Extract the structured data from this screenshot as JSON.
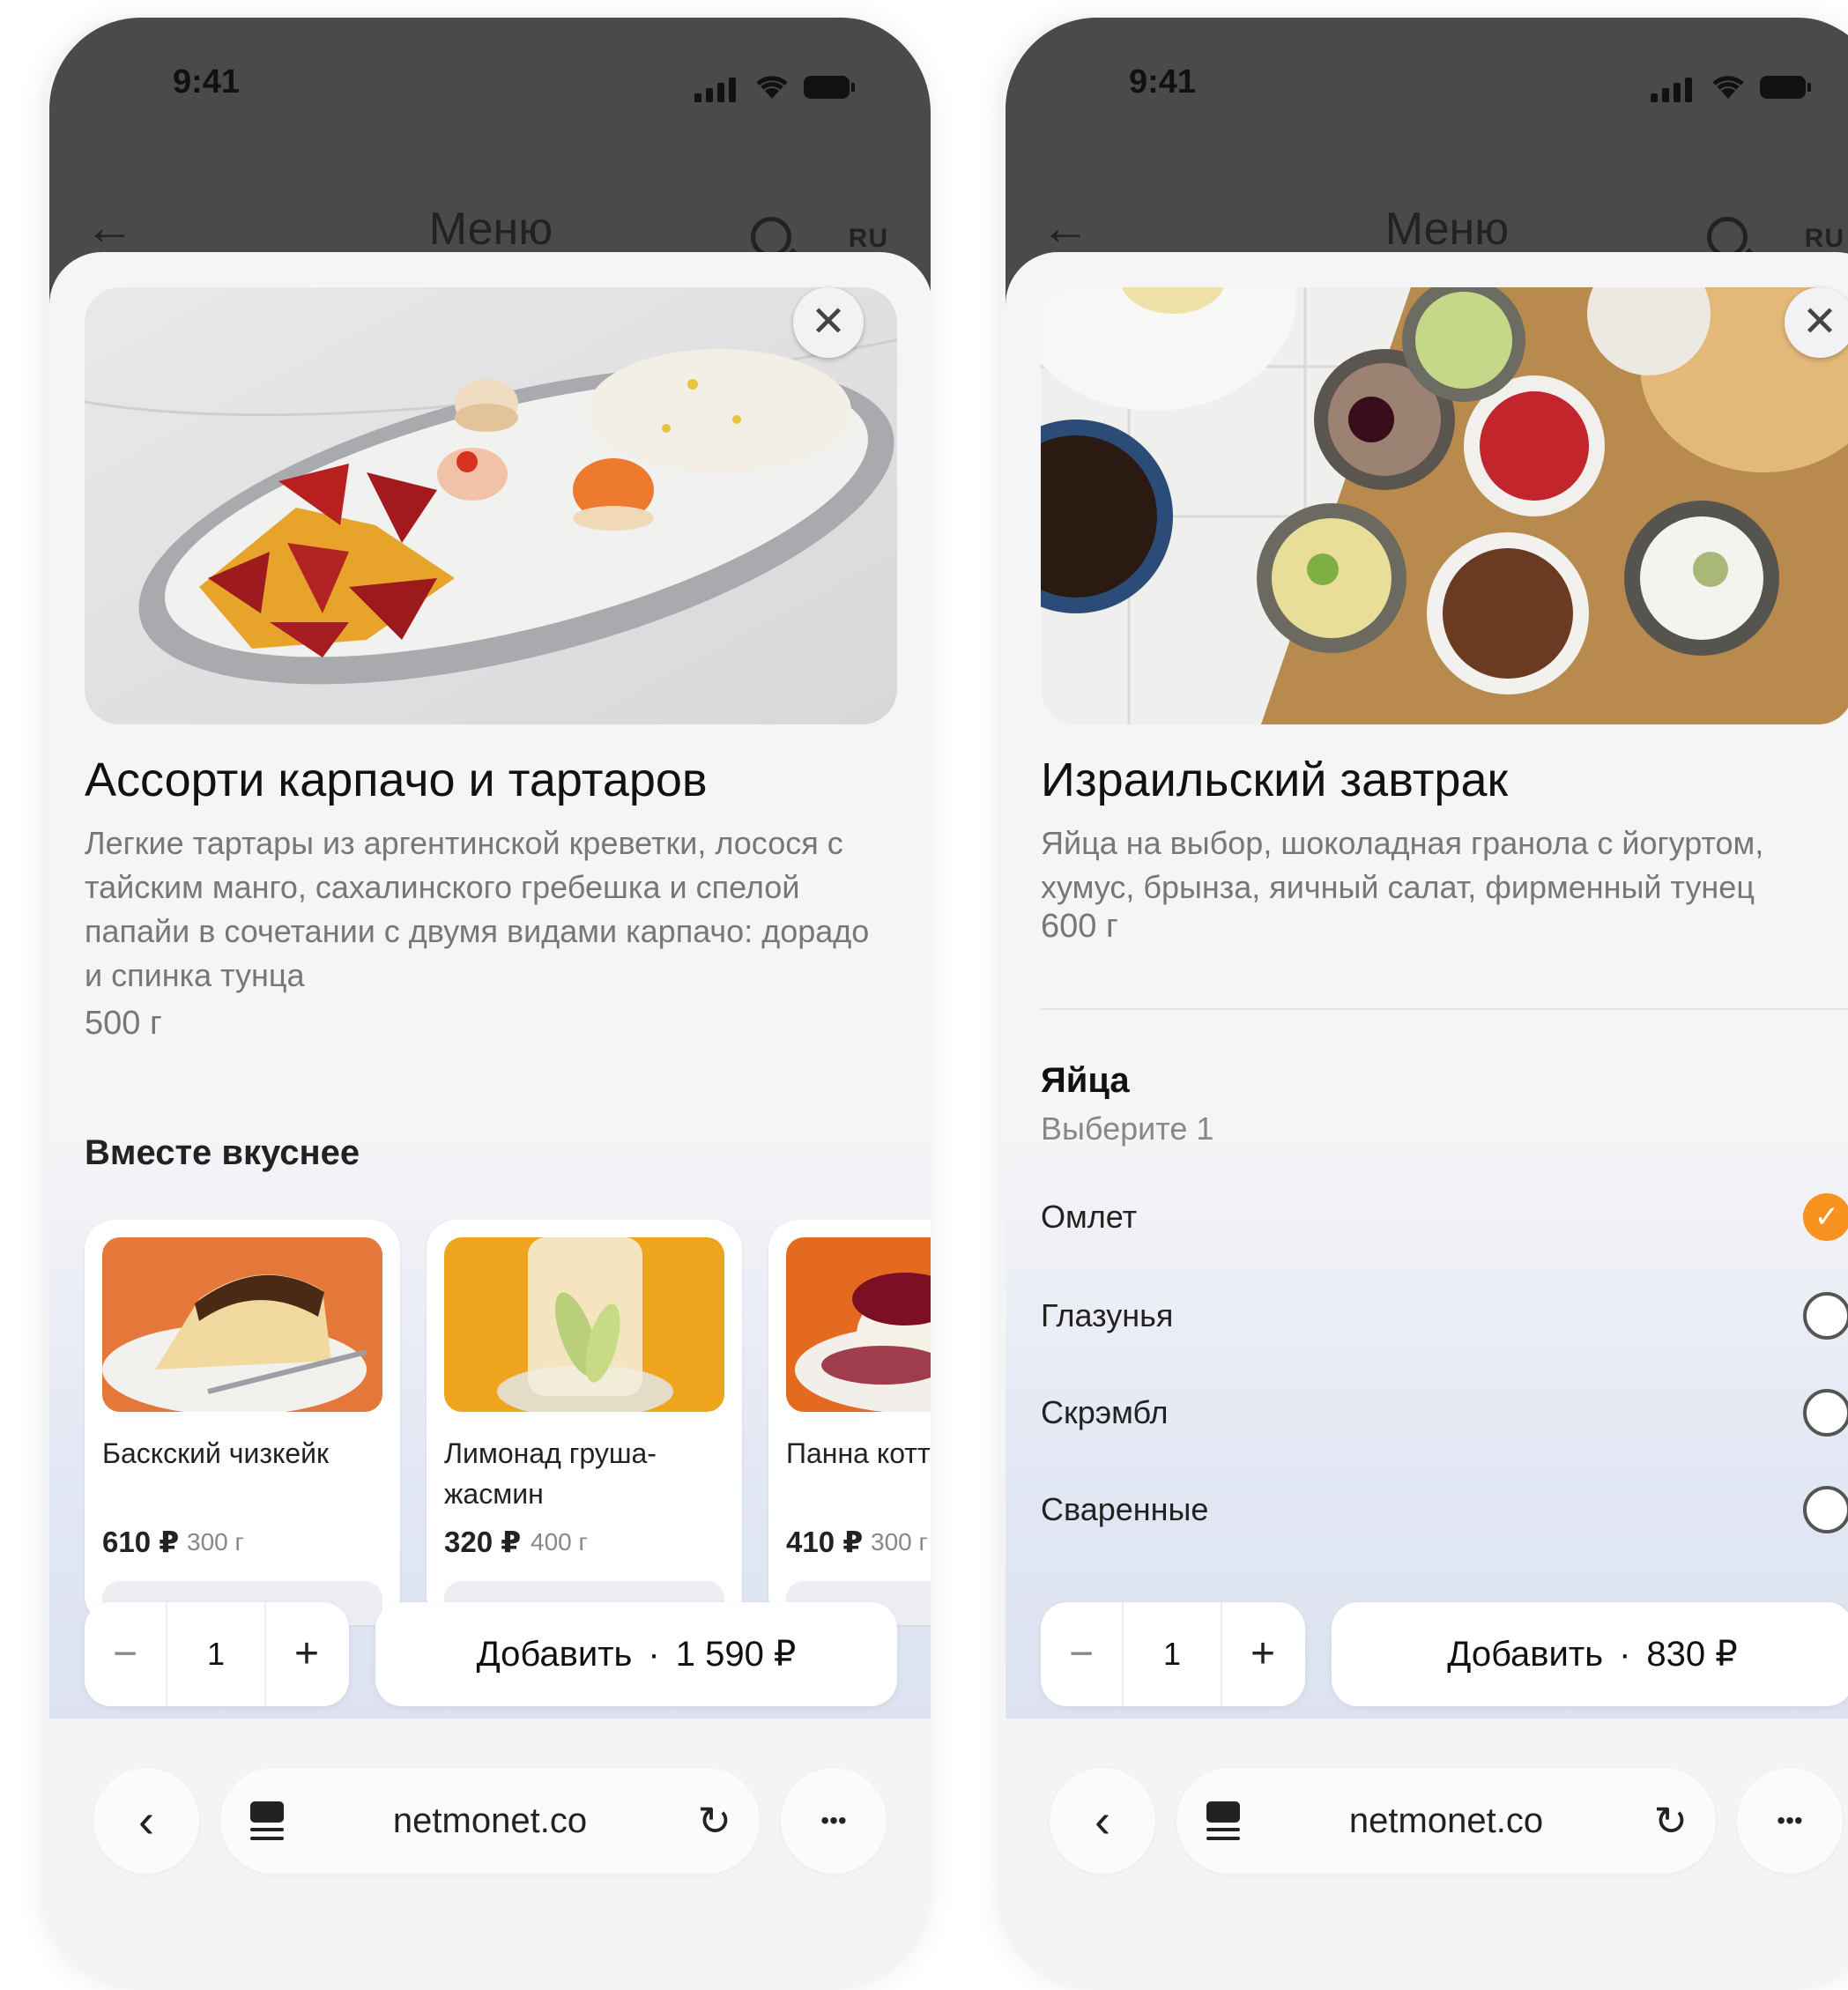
{
  "phones": [
    {
      "status": {
        "time": "9:41"
      },
      "nav": {
        "back": "←",
        "title": "Меню",
        "lang": "RU"
      },
      "dish": {
        "title": "Ассорти карпачо и тартаров",
        "description": "Легкие тартары из аргентинской креветки, лосося с тайским манго, сахалинского гребешка и спелой папайи в сочетании с двумя видами карпачо: дорадо и спинка тунца",
        "weight": "500 г"
      },
      "section_title": "Вместе вкуснее",
      "cards": [
        {
          "name": "Баскский чизкейк",
          "price": "610 ₽",
          "weight": "300 г"
        },
        {
          "name": "Лимонад груша-жасмин",
          "price": "320 ₽",
          "weight": "400 г"
        },
        {
          "name": "Панна котта",
          "price": "410 ₽",
          "weight": "300 г"
        }
      ],
      "qty": {
        "minus": "−",
        "value": "1",
        "plus": "+"
      },
      "add": {
        "label": "Добавить",
        "dot": "·",
        "price": "1 590 ₽"
      },
      "browser": {
        "domain": "netmonet.co",
        "back": "‹",
        "reload": "↻",
        "more": "•••"
      }
    },
    {
      "status": {
        "time": "9:41"
      },
      "nav": {
        "back": "←",
        "title": "Меню",
        "lang": "RU"
      },
      "dish": {
        "title": "Израильский завтрак",
        "description": "Яйца на выбор, шоколадная гранола с йогуртом, хумус, брынза, яичный салат, фирменный тунец",
        "weight": "600 г"
      },
      "options_group": {
        "title": "Яйца",
        "subtitle": "Выберите 1",
        "items": [
          {
            "label": "Омлет",
            "selected": true
          },
          {
            "label": "Глазунья",
            "selected": false
          },
          {
            "label": "Скрэмбл",
            "selected": false
          },
          {
            "label": "Сваренные",
            "selected": false
          }
        ]
      },
      "qty": {
        "minus": "−",
        "value": "1",
        "plus": "+"
      },
      "add": {
        "label": "Добавить",
        "dot": "·",
        "price": "830 ₽"
      },
      "browser": {
        "domain": "netmonet.co",
        "back": "‹",
        "reload": "↻",
        "more": "•••"
      }
    }
  ],
  "colors": {
    "accent": "#f7931e",
    "statusbar_bg": "#4a4a4a",
    "sheet_bg": "#f5f5f7"
  }
}
